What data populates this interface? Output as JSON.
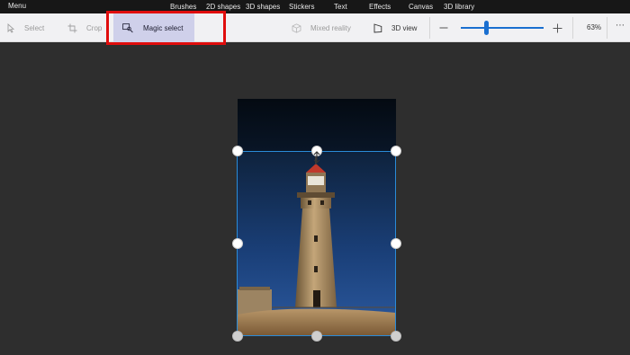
{
  "menubar": {
    "menu_label": "Menu",
    "tabs": [
      "Brushes",
      "2D shapes",
      "3D shapes",
      "Stickers",
      "Text",
      "Effects",
      "Canvas",
      "3D library"
    ]
  },
  "toolbar": {
    "select_label": "Select",
    "crop_label": "Crop",
    "magic_select_label": "Magic select",
    "mixed_reality_label": "Mixed reality",
    "view_3d_label": "3D view",
    "zoom_value": "63%",
    "zoom_fraction": 0.31
  },
  "colors": {
    "accent": "#1a6fd0",
    "highlight_box": "#e00d0d",
    "selection_border": "#2a8bd8"
  }
}
